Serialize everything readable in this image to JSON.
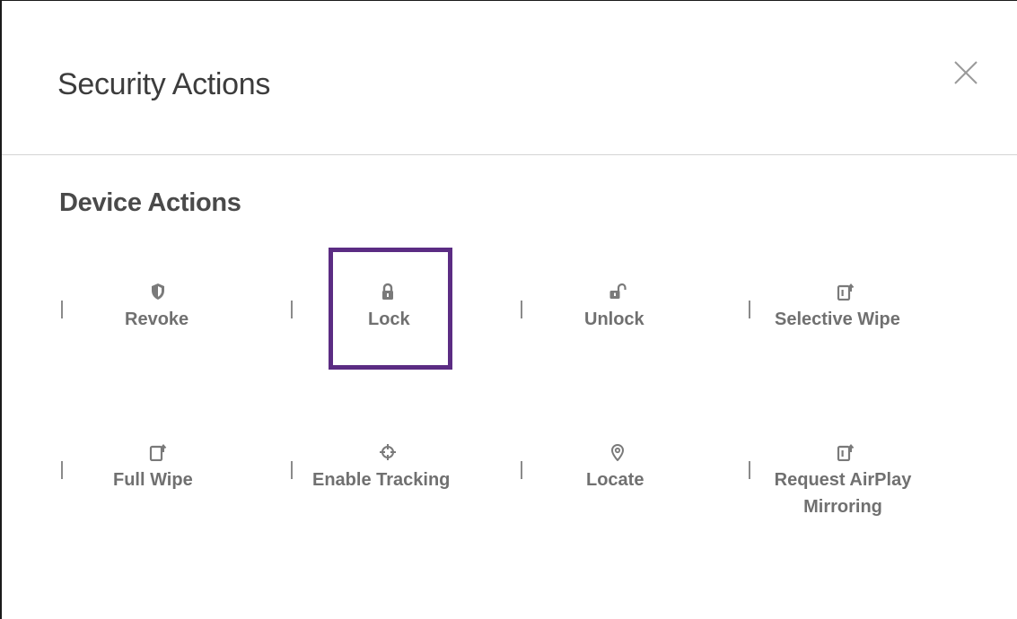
{
  "dialog": {
    "title": "Security Actions",
    "close_icon": "close-icon"
  },
  "device_actions": {
    "title": "Device Actions",
    "items": [
      {
        "label": "Revoke",
        "icon": "shield-icon"
      },
      {
        "label": "Lock",
        "icon": "lock-icon"
      },
      {
        "label": "Unlock",
        "icon": "unlock-icon"
      },
      {
        "label": "Selective Wipe",
        "icon": "selective-wipe-icon"
      },
      {
        "label": "Full Wipe",
        "icon": "full-wipe-icon"
      },
      {
        "label": "Enable Tracking",
        "icon": "crosshair-icon"
      },
      {
        "label": "Locate",
        "icon": "location-pin-icon"
      },
      {
        "label": "Request AirPlay",
        "label_line2": "Mirroring",
        "icon": "airplay-icon"
      }
    ],
    "focused_item": "Lock"
  },
  "colors": {
    "focus": "#5b2c83",
    "text_muted": "#707070",
    "title": "#3c3c3c"
  }
}
